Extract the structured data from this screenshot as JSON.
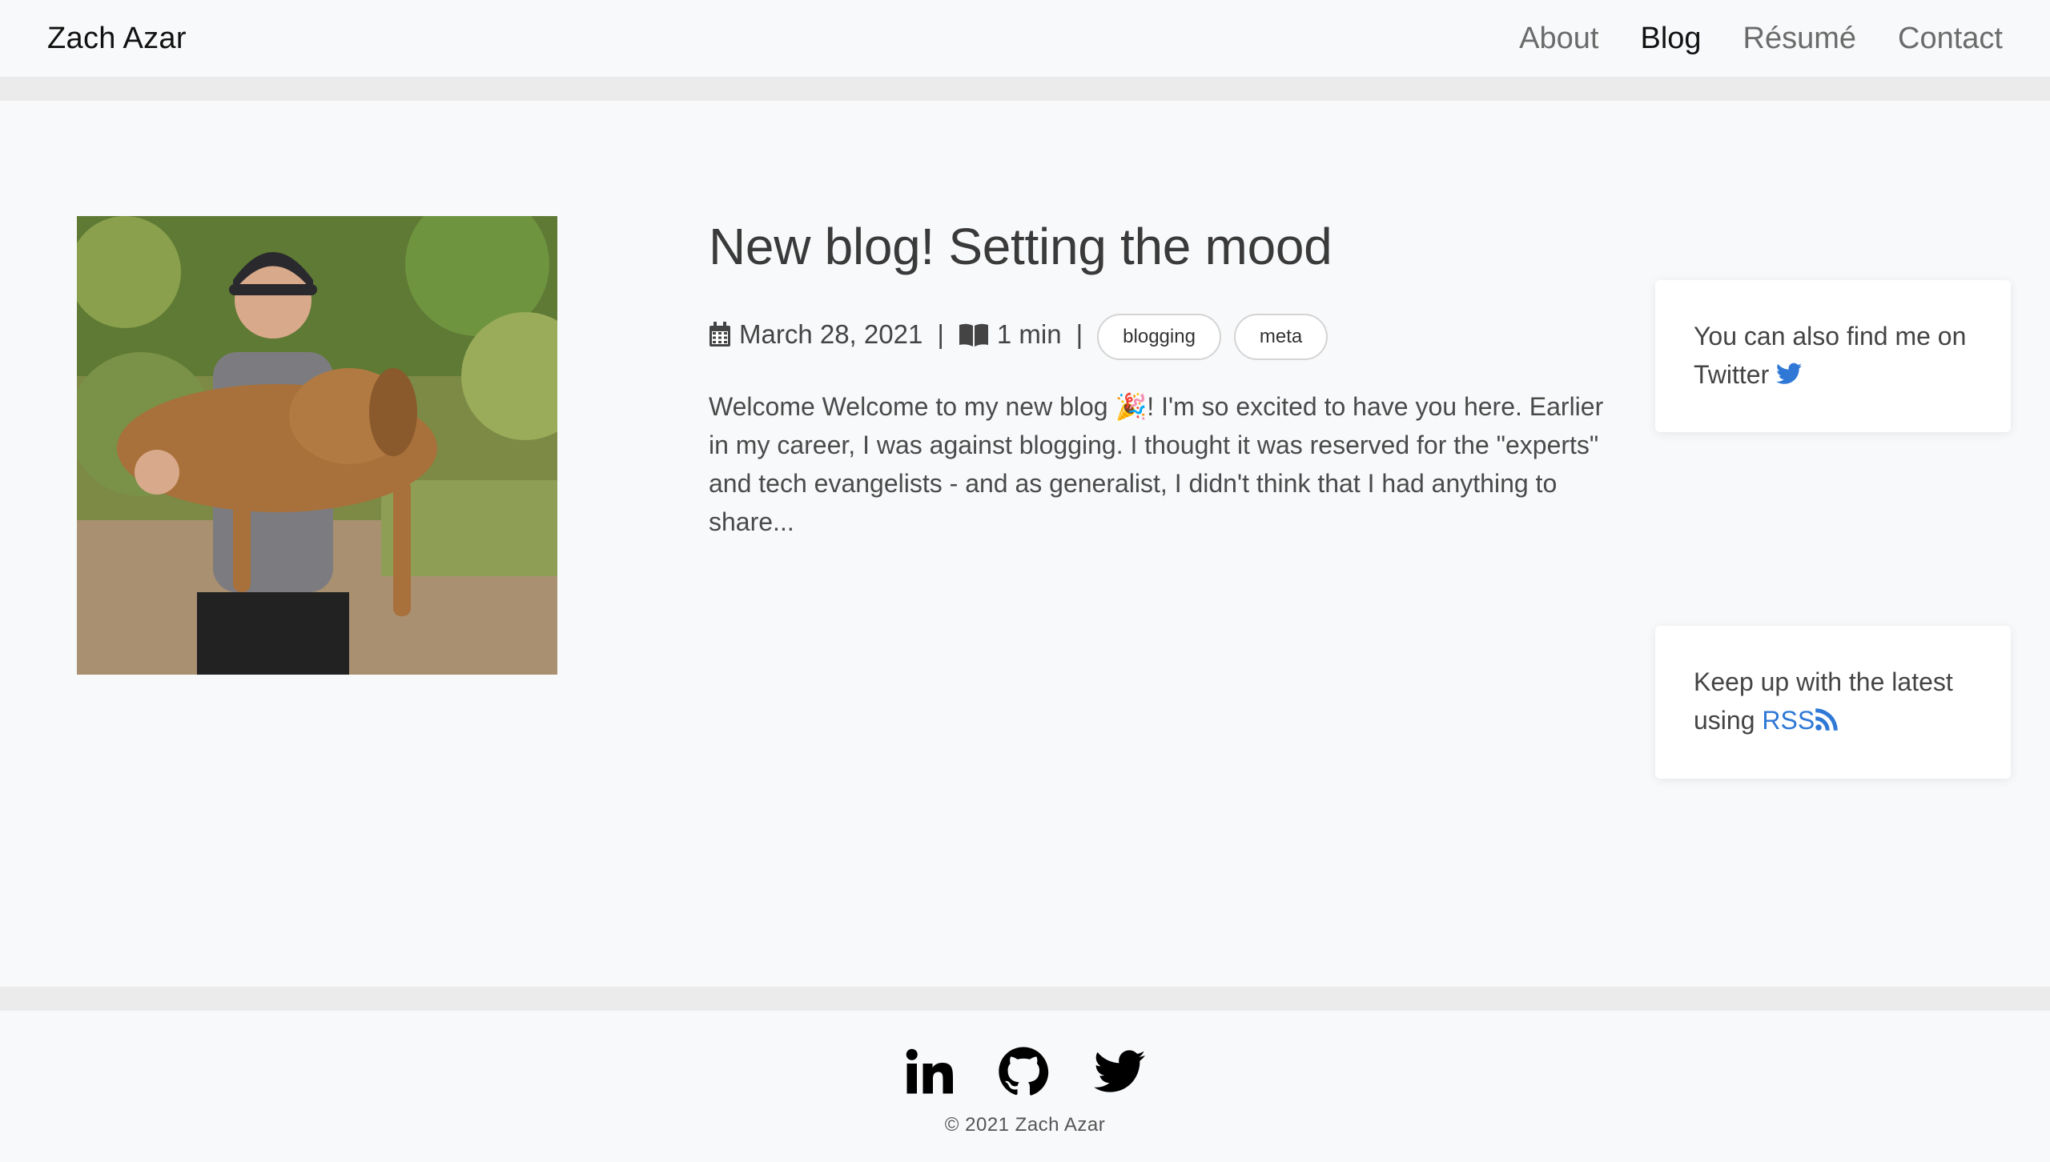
{
  "header": {
    "brand": "Zach Azar",
    "nav": [
      {
        "label": "About"
      },
      {
        "label": "Blog"
      },
      {
        "label": "Résumé"
      },
      {
        "label": "Contact"
      }
    ]
  },
  "post": {
    "title": "New blog! Setting the mood",
    "date": "March 28, 2021",
    "read_time": "1 min",
    "separator": "|",
    "tags": [
      "blogging",
      "meta"
    ],
    "excerpt": "Welcome Welcome to my new blog 🎉! I'm so excited to have you here. Earlier in my career, I was against blogging. I thought it was reserved for the \"experts\" and tech evangelists - and as generalist, I didn't think that I had anything to share..."
  },
  "sidebar": {
    "twitter_text": "You can also find me on",
    "twitter_link": "Twitter",
    "rss_text": "Keep up with the latest using",
    "rss_link": "RSS"
  },
  "footer": {
    "copyright": "© 2021 Zach Azar",
    "social_icons": [
      "linkedin-icon",
      "github-icon",
      "twitter-icon"
    ]
  },
  "colors": {
    "link": "#2f78d6",
    "band": "#ebebeb",
    "background": "#f8f9fa"
  }
}
